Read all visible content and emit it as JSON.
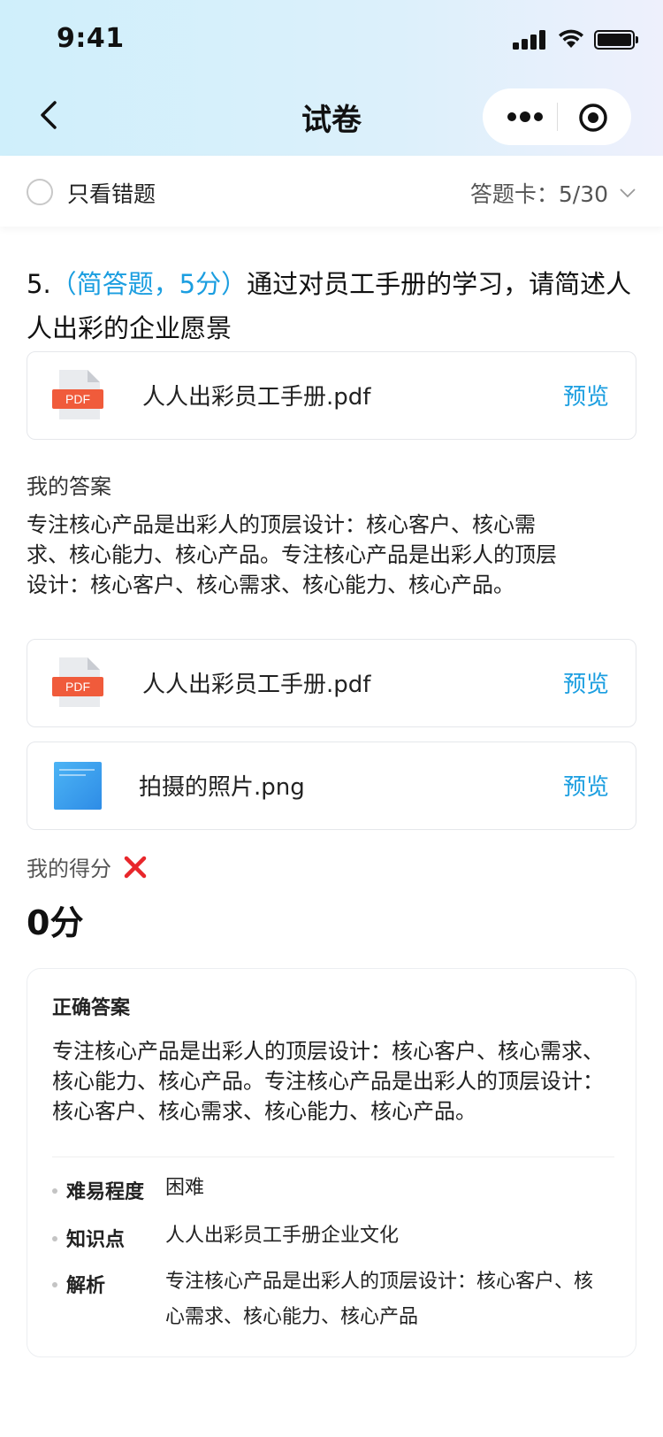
{
  "status_bar": {
    "time": "9:41"
  },
  "nav": {
    "title": "试卷"
  },
  "filter": {
    "only_wrong_label": "只看错题",
    "answer_card_label": "答题卡：5/30"
  },
  "question": {
    "number": "5.",
    "meta": "（简答题，5分）",
    "text": "通过对员工手册的学习，请简述人人出彩的企业愿景"
  },
  "question_attachment": {
    "name": "人人出彩员工手册.pdf",
    "preview": "预览",
    "icon": "pdf-icon",
    "icon_label": "PDF"
  },
  "my_answer": {
    "label": "我的答案",
    "text": "专注核心产品是出彩人的顶层设计：核心客户、核心需求、核心能力、核心产品。专注核心产品是出彩人的顶层设计：核心客户、核心需求、核心能力、核心产品。",
    "attachments": [
      {
        "name": "人人出彩员工手册.pdf",
        "preview": "预览",
        "icon": "pdf-icon",
        "icon_label": "PDF"
      },
      {
        "name": "拍摄的照片.png",
        "preview": "预览",
        "icon": "image-thumbnail"
      }
    ]
  },
  "score": {
    "label": "我的得分",
    "value": "0分",
    "status_icon": "wrong-x-icon",
    "status_color": "#e8262b"
  },
  "correct": {
    "title": "正确答案",
    "text": "专注核心产品是出彩人的顶层设计：核心客户、核心需求、核心能力、核心产品。专注核心产品是出彩人的顶层设计：核心客户、核心需求、核心能力、核心产品。",
    "meta": [
      {
        "key": "难易程度",
        "value": "困难"
      },
      {
        "key": "知识点",
        "value": "人人出彩员工手册企业文化"
      },
      {
        "key": "解析",
        "value": "专注核心产品是出彩人的顶层设计：核心客户、核心需求、核心能力、核心产品"
      }
    ]
  },
  "colors": {
    "accent": "#1b9ee0",
    "pdf_red": "#f05b3b",
    "error": "#e8262b"
  }
}
